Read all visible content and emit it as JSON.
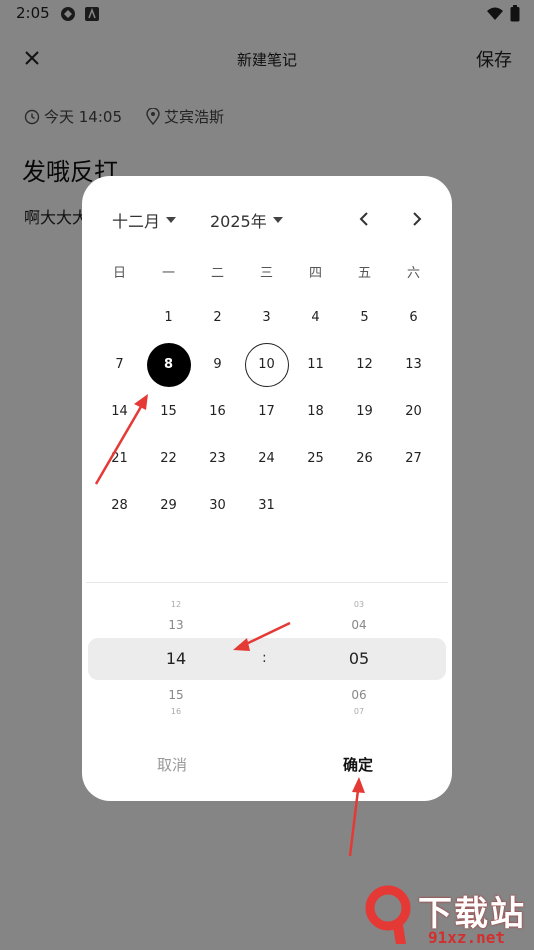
{
  "status_bar": {
    "time": "2:05"
  },
  "topbar": {
    "title": "新建笔记",
    "save_label": "保存"
  },
  "meta": {
    "time_label": "今天 14:05",
    "location_label": "艾宾浩斯"
  },
  "note": {
    "title": "发哦反打",
    "body": "啊大大大"
  },
  "calendar": {
    "month_label": "十二月",
    "year_label": "2025年",
    "weekdays": [
      "日",
      "一",
      "二",
      "三",
      "四",
      "五",
      "六"
    ],
    "days": {
      "d1": "1",
      "d2": "2",
      "d3": "3",
      "d4": "4",
      "d5": "5",
      "d6": "6",
      "d7": "7",
      "d8": "8",
      "d9": "9",
      "d10": "10",
      "d11": "11",
      "d12": "12",
      "d13": "13",
      "d14": "14",
      "d15": "15",
      "d16": "16",
      "d17": "17",
      "d18": "18",
      "d19": "19",
      "d20": "20",
      "d21": "21",
      "d22": "22",
      "d23": "23",
      "d24": "24",
      "d25": "25",
      "d26": "26",
      "d27": "27",
      "d28": "28",
      "d29": "29",
      "d30": "30",
      "d31": "31"
    },
    "selected_day": "8",
    "today_day": "10"
  },
  "time_picker": {
    "hour": {
      "far_prev": "12",
      "prev": "13",
      "current": "14",
      "next": "15",
      "far_next": "16"
    },
    "minute": {
      "far_prev": "03",
      "prev": "04",
      "current": "05",
      "next": "06",
      "far_next": "07"
    },
    "separator": ":"
  },
  "dialog": {
    "cancel_label": "取消",
    "ok_label": "确定"
  },
  "watermark": {
    "brand": "下载站",
    "url": "91xz.net"
  },
  "colors": {
    "accent": "#000000",
    "overlay": "rgba(0,0,0,0.48)",
    "arrow": "#e53935"
  }
}
